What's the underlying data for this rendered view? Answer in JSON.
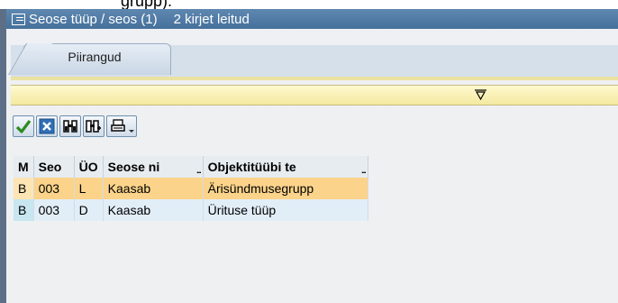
{
  "top_cut_text": "grupp).",
  "window": {
    "title": "Seose tüüp / seos (1)",
    "records_found": "2 kirjet leitud"
  },
  "tabs": [
    {
      "label": "Piirangud"
    }
  ],
  "toolbar": {
    "buttons": [
      {
        "name": "accept",
        "icon": "checkmark-icon"
      },
      {
        "name": "cancel",
        "icon": "close-icon"
      },
      {
        "name": "find",
        "icon": "binoculars-icon"
      },
      {
        "name": "find-next",
        "icon": "binoculars-plus-icon"
      },
      {
        "name": "print",
        "icon": "printer-icon"
      }
    ]
  },
  "grid": {
    "columns": [
      "M",
      "Seo",
      "ÜO",
      "Seose ni",
      "Objektitüübi te"
    ],
    "rows": [
      [
        "B",
        "003",
        "L",
        "Kaasab",
        "Ärisündmusegrupp"
      ],
      [
        "B",
        "003",
        "D",
        "Kaasab",
        "Ürituse tüüp"
      ]
    ]
  },
  "colors": {
    "title_bar": "#4f7aa5",
    "selected_row": "#fbd38a",
    "filter_bar": "#fbf2b8",
    "accept_green": "#2e8b1e"
  }
}
